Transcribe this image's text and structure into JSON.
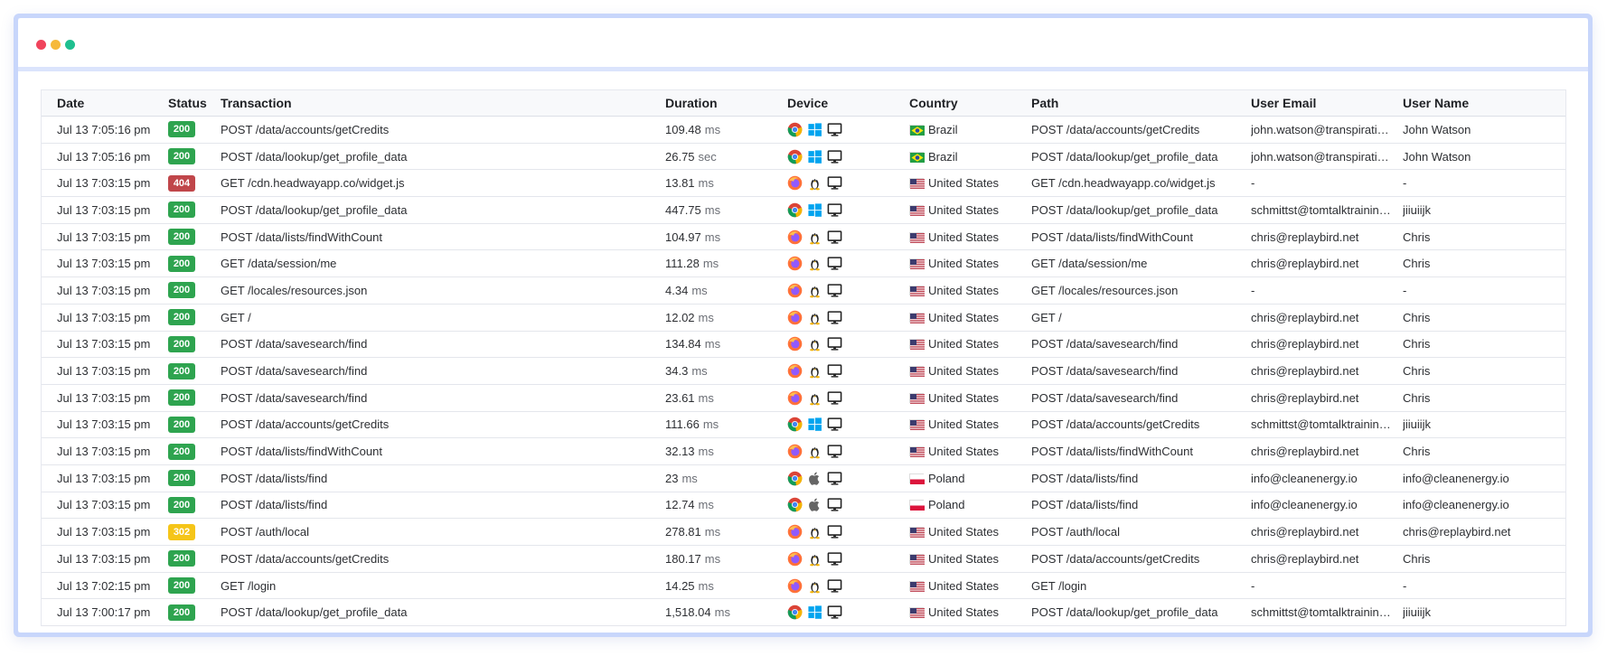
{
  "colors": {
    "status_200": "#2ea44f",
    "status_404": "#c0464a",
    "status_302": "#f5c518",
    "window_border": "#c8d6fb"
  },
  "headers": {
    "date": "Date",
    "status": "Status",
    "transaction": "Transaction",
    "duration": "Duration",
    "device": "Device",
    "country": "Country",
    "path": "Path",
    "email": "User Email",
    "name": "User Name"
  },
  "rows": [
    {
      "date": "Jul 13 7:05:16 pm",
      "status": "200",
      "transaction": "POST /data/accounts/getCredits",
      "duration": "109.48",
      "unit": "ms",
      "browser": "chrome-icon",
      "os": "windows-icon",
      "country": "Brazil",
      "flag": "brazil-flag-icon",
      "path": "POST /data/accounts/getCredits",
      "email": "john.watson@transpiration.com",
      "name": "John Watson"
    },
    {
      "date": "Jul 13 7:05:16 pm",
      "status": "200",
      "transaction": "POST /data/lookup/get_profile_data",
      "duration": "26.75",
      "unit": "sec",
      "browser": "chrome-icon",
      "os": "windows-icon",
      "country": "Brazil",
      "flag": "brazil-flag-icon",
      "path": "POST /data/lookup/get_profile_data",
      "email": "john.watson@transpiration.com",
      "name": "John Watson"
    },
    {
      "date": "Jul 13 7:03:15 pm",
      "status": "404",
      "transaction": "GET /cdn.headwayapp.co/widget.js",
      "duration": "13.81",
      "unit": "ms",
      "browser": "firefox-icon",
      "os": "linux-icon",
      "country": "United States",
      "flag": "us-flag-icon",
      "path": "GET /cdn.headwayapp.co/widget.js",
      "email": "-",
      "name": "-"
    },
    {
      "date": "Jul 13 7:03:15 pm",
      "status": "200",
      "transaction": "POST /data/lookup/get_profile_data",
      "duration": "447.75",
      "unit": "ms",
      "browser": "chrome-icon",
      "os": "windows-icon",
      "country": "United States",
      "flag": "us-flag-icon",
      "path": "POST /data/lookup/get_profile_data",
      "email": "schmittst@tomtalktraining.com",
      "name": "jiiuiijk"
    },
    {
      "date": "Jul 13 7:03:15 pm",
      "status": "200",
      "transaction": "POST /data/lists/findWithCount",
      "duration": "104.97",
      "unit": "ms",
      "browser": "firefox-icon",
      "os": "linux-icon",
      "country": "United States",
      "flag": "us-flag-icon",
      "path": "POST /data/lists/findWithCount",
      "email": "chris@replaybird.net",
      "name": "Chris"
    },
    {
      "date": "Jul 13 7:03:15 pm",
      "status": "200",
      "transaction": "GET /data/session/me",
      "duration": "111.28",
      "unit": "ms",
      "browser": "firefox-icon",
      "os": "linux-icon",
      "country": "United States",
      "flag": "us-flag-icon",
      "path": "GET /data/session/me",
      "email": "chris@replaybird.net",
      "name": "Chris"
    },
    {
      "date": "Jul 13 7:03:15 pm",
      "status": "200",
      "transaction": "GET /locales/resources.json",
      "duration": "4.34",
      "unit": "ms",
      "browser": "firefox-icon",
      "os": "linux-icon",
      "country": "United States",
      "flag": "us-flag-icon",
      "path": "GET /locales/resources.json",
      "email": "-",
      "name": "-"
    },
    {
      "date": "Jul 13 7:03:15 pm",
      "status": "200",
      "transaction": "GET /",
      "duration": "12.02",
      "unit": "ms",
      "browser": "firefox-icon",
      "os": "linux-icon",
      "country": "United States",
      "flag": "us-flag-icon",
      "path": "GET /",
      "email": "chris@replaybird.net",
      "name": "Chris"
    },
    {
      "date": "Jul 13 7:03:15 pm",
      "status": "200",
      "transaction": "POST /data/savesearch/find",
      "duration": "134.84",
      "unit": "ms",
      "browser": "firefox-icon",
      "os": "linux-icon",
      "country": "United States",
      "flag": "us-flag-icon",
      "path": "POST /data/savesearch/find",
      "email": "chris@replaybird.net",
      "name": "Chris"
    },
    {
      "date": "Jul 13 7:03:15 pm",
      "status": "200",
      "transaction": "POST /data/savesearch/find",
      "duration": "34.3",
      "unit": "ms",
      "browser": "firefox-icon",
      "os": "linux-icon",
      "country": "United States",
      "flag": "us-flag-icon",
      "path": "POST /data/savesearch/find",
      "email": "chris@replaybird.net",
      "name": "Chris"
    },
    {
      "date": "Jul 13 7:03:15 pm",
      "status": "200",
      "transaction": "POST /data/savesearch/find",
      "duration": "23.61",
      "unit": "ms",
      "browser": "firefox-icon",
      "os": "linux-icon",
      "country": "United States",
      "flag": "us-flag-icon",
      "path": "POST /data/savesearch/find",
      "email": "chris@replaybird.net",
      "name": "Chris"
    },
    {
      "date": "Jul 13 7:03:15 pm",
      "status": "200",
      "transaction": "POST /data/accounts/getCredits",
      "duration": "111.66",
      "unit": "ms",
      "browser": "chrome-icon",
      "os": "windows-icon",
      "country": "United States",
      "flag": "us-flag-icon",
      "path": "POST /data/accounts/getCredits",
      "email": "schmittst@tomtalktraining.com",
      "name": "jiiuiijk"
    },
    {
      "date": "Jul 13 7:03:15 pm",
      "status": "200",
      "transaction": "POST /data/lists/findWithCount",
      "duration": "32.13",
      "unit": "ms",
      "browser": "firefox-icon",
      "os": "linux-icon",
      "country": "United States",
      "flag": "us-flag-icon",
      "path": "POST /data/lists/findWithCount",
      "email": "chris@replaybird.net",
      "name": "Chris"
    },
    {
      "date": "Jul 13 7:03:15 pm",
      "status": "200",
      "transaction": "POST /data/lists/find",
      "duration": "23",
      "unit": "ms",
      "browser": "chrome-icon",
      "os": "apple-icon",
      "country": "Poland",
      "flag": "poland-flag-icon",
      "path": "POST /data/lists/find",
      "email": "info@cleanenergy.io",
      "name": "info@cleanenergy.io"
    },
    {
      "date": "Jul 13 7:03:15 pm",
      "status": "200",
      "transaction": "POST /data/lists/find",
      "duration": "12.74",
      "unit": "ms",
      "browser": "chrome-icon",
      "os": "apple-icon",
      "country": "Poland",
      "flag": "poland-flag-icon",
      "path": "POST /data/lists/find",
      "email": "info@cleanenergy.io",
      "name": "info@cleanenergy.io"
    },
    {
      "date": "Jul 13 7:03:15 pm",
      "status": "302",
      "transaction": "POST /auth/local",
      "duration": "278.81",
      "unit": "ms",
      "browser": "firefox-icon",
      "os": "linux-icon",
      "country": "United States",
      "flag": "us-flag-icon",
      "path": "POST /auth/local",
      "email": "chris@replaybird.net",
      "name": "chris@replaybird.net"
    },
    {
      "date": "Jul 13 7:03:15 pm",
      "status": "200",
      "transaction": "POST /data/accounts/getCredits",
      "duration": "180.17",
      "unit": "ms",
      "browser": "firefox-icon",
      "os": "linux-icon",
      "country": "United States",
      "flag": "us-flag-icon",
      "path": "POST /data/accounts/getCredits",
      "email": "chris@replaybird.net",
      "name": "Chris"
    },
    {
      "date": "Jul 13 7:02:15 pm",
      "status": "200",
      "transaction": "GET /login",
      "duration": "14.25",
      "unit": "ms",
      "browser": "firefox-icon",
      "os": "linux-icon",
      "country": "United States",
      "flag": "us-flag-icon",
      "path": "GET /login",
      "email": "-",
      "name": "-"
    },
    {
      "date": "Jul 13 7:00:17 pm",
      "status": "200",
      "transaction": "POST /data/lookup/get_profile_data",
      "duration": "1,518.04",
      "unit": "ms",
      "browser": "chrome-icon",
      "os": "windows-icon",
      "country": "United States",
      "flag": "us-flag-icon",
      "path": "POST /data/lookup/get_profile_data",
      "email": "schmittst@tomtalktraining.com",
      "name": "jiiuiijk"
    }
  ]
}
